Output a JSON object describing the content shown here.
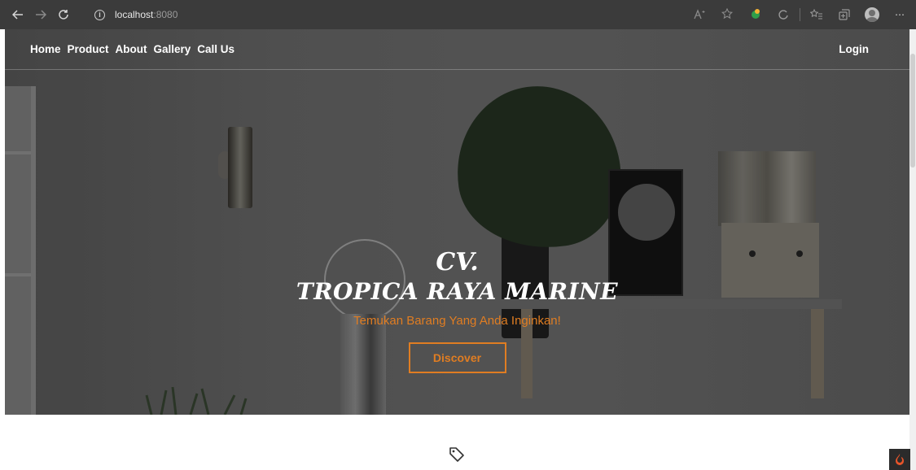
{
  "browser": {
    "url_host": "localhost",
    "url_port": ":8080",
    "back_icon": "arrow-left-icon",
    "forward_icon": "arrow-right-icon",
    "refresh_icon": "refresh-icon"
  },
  "nav": {
    "links": [
      {
        "label": "Home"
      },
      {
        "label": "Product"
      },
      {
        "label": "About"
      },
      {
        "label": "Gallery"
      },
      {
        "label": "Call Us"
      }
    ],
    "login_label": "Login"
  },
  "hero": {
    "brand_line1": "CV.",
    "brand_line2": "TROPICA RAYA MARINE",
    "tagline": "Temukan Barang Yang Anda Inginkan!",
    "cta_label": "Discover"
  },
  "colors": {
    "accent": "#e07d22",
    "chrome": "#3b3b3b"
  }
}
